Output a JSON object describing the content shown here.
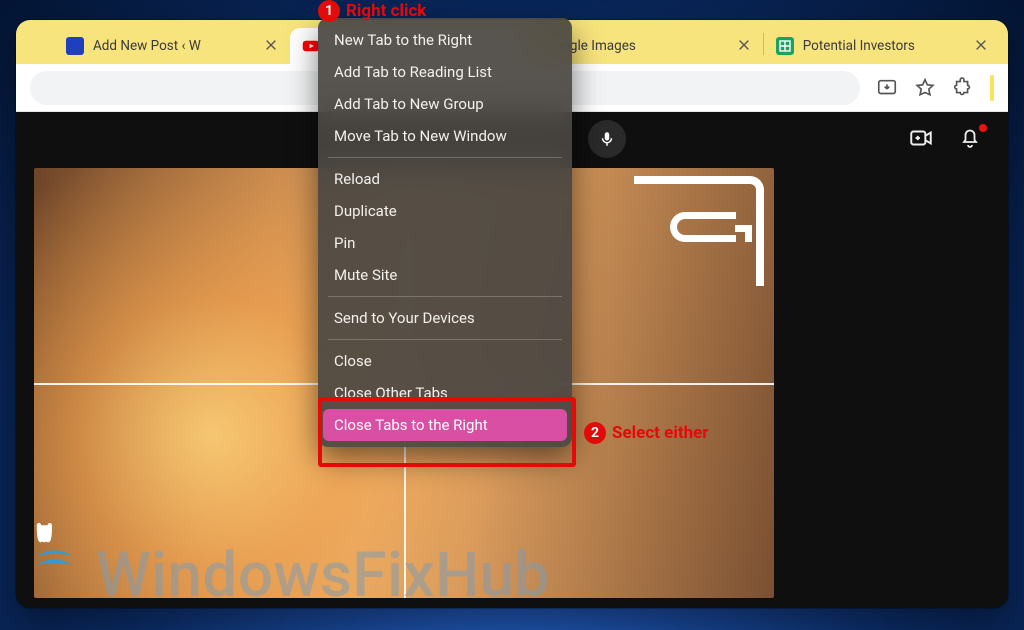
{
  "tabs": [
    {
      "title": "Add New Post ‹ W",
      "favicon_color": "#1f3fbf"
    },
    {
      "title": "",
      "favicon_color": "#ff0000"
    },
    {
      "title": "oogle Images",
      "favicon_color": "#ffffff"
    },
    {
      "title": "Potential Investors",
      "favicon_color": "#1aa260"
    }
  ],
  "context_menu": {
    "items": [
      "New Tab to the Right",
      "Add Tab to Reading List",
      "Add Tab to New Group",
      "Move Tab to New Window",
      "-",
      "Reload",
      "Duplicate",
      "Pin",
      "Mute Site",
      "-",
      "Send to Your Devices",
      "-",
      "Close",
      "Close Other Tabs",
      "Close Tabs to the Right"
    ],
    "hovered": "Close Tabs to the Right"
  },
  "callouts": {
    "one_num": "1",
    "one_text": "Right click",
    "two_num": "2",
    "two_text": "Select either"
  },
  "watermark": "WindowsFixHub"
}
